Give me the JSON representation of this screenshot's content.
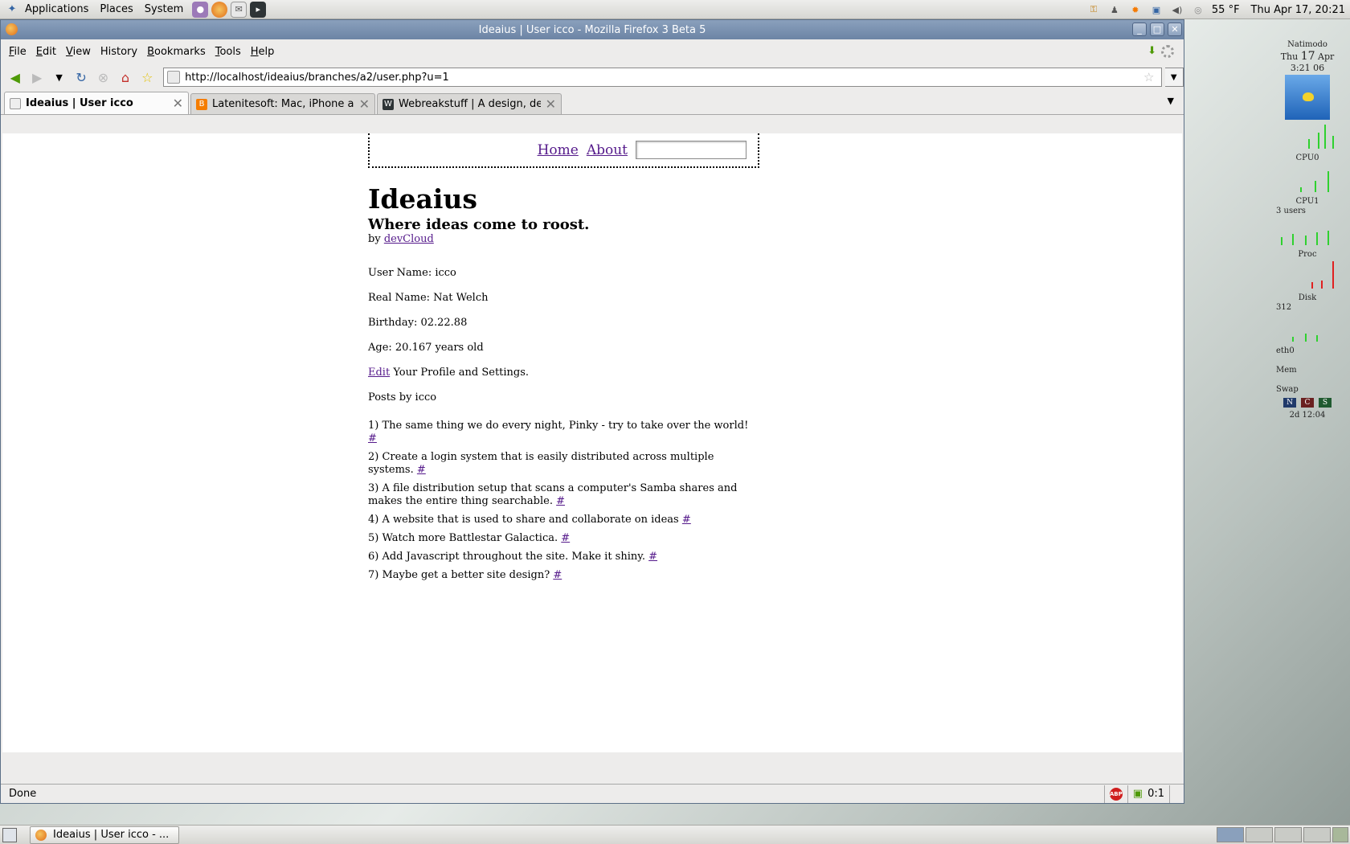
{
  "top_panel": {
    "menus": [
      "Applications",
      "Places",
      "System"
    ],
    "weather": "55 °F",
    "clock": "Thu Apr 17, 20:21"
  },
  "window": {
    "title": "Ideaius | User icco - Mozilla Firefox 3 Beta 5"
  },
  "menubar": {
    "items": [
      {
        "accel": "F",
        "rest": "ile"
      },
      {
        "accel": "E",
        "rest": "dit"
      },
      {
        "accel": "V",
        "rest": "iew"
      },
      {
        "accel": "H",
        "rest": "istory"
      },
      {
        "accel": "B",
        "rest": "ookmarks"
      },
      {
        "accel": "T",
        "rest": "ools"
      },
      {
        "accel": "H",
        "rest": "elp"
      }
    ]
  },
  "navbar": {
    "url": "http://localhost/ideaius/branches/a2/user.php?u=1"
  },
  "tabs": [
    {
      "label": "Ideaius | User icco",
      "active": true
    },
    {
      "label": "Latenitesoft: Mac, iPhone a...",
      "active": false
    },
    {
      "label": "Webreakstuff | A design, de...",
      "active": false
    }
  ],
  "page": {
    "nav": {
      "home": "Home",
      "about": "About"
    },
    "title": "Ideaius",
    "tagline": "Where ideas come to roost.",
    "by_prefix": "by",
    "by_link": "devCloud",
    "user_name": "User Name: icco",
    "real_name": "Real Name: Nat Welch",
    "birthday": "Birthday: 02.22.88",
    "age": "Age: 20.167 years old",
    "edit_link": "Edit",
    "edit_rest": " Your Profile and Settings.",
    "posts_heading": "Posts by icco",
    "post_link": "#",
    "posts": [
      "1) The same thing we do every night, Pinky - try to take over the world! ",
      "2) Create a login system that is easily distributed across multiple systems. ",
      "3) A file distribution setup that scans a computer's Samba shares and makes the entire thing searchable. ",
      "4) A website that is used to share and collaborate on ideas ",
      "5) Watch more Battlestar Galactica. ",
      "6) Add Javascript throughout the site. Make it shiny. ",
      "7) Maybe get a better site design? "
    ]
  },
  "statusbar": {
    "text": "Done",
    "counter": "0:1"
  },
  "gkrellm": {
    "hostname": "Natimodo",
    "day": "Thu",
    "date_num": "17",
    "month": "Apr",
    "time": "3:21 06",
    "labels": [
      "CPU0",
      "CPU1",
      "Proc",
      "Disk",
      "eth0",
      "Mem",
      "Swap"
    ],
    "proc_users": "3 users",
    "disk_value": "312",
    "uptime": "2d 12:04",
    "buttons": [
      "N",
      "C",
      "S"
    ]
  },
  "taskbar": {
    "task_label": "Ideaius | User icco - ..."
  },
  "colors": {
    "link": "#551a8b",
    "titlebar": "#7690b1",
    "graph_green": "#2fd12f",
    "graph_red": "#e02020"
  }
}
